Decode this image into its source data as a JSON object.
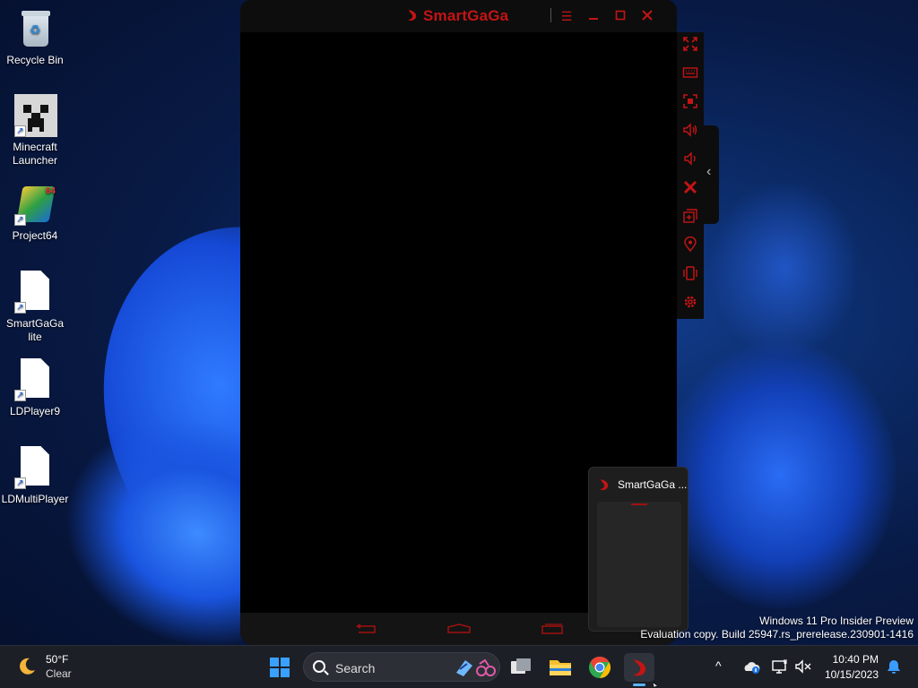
{
  "desktop": {
    "icons": [
      {
        "label": "Recycle Bin",
        "icon": "recycle-bin-icon"
      },
      {
        "label": "Minecraft Launcher",
        "icon": "minecraft-icon"
      },
      {
        "label": "Project64",
        "icon": "project64-icon"
      },
      {
        "label": "SmartGaGa lite",
        "icon": "file-icon"
      },
      {
        "label": "LDPlayer9",
        "icon": "file-icon"
      },
      {
        "label": "LDMultiPlayer",
        "icon": "file-icon"
      }
    ]
  },
  "smartgaga": {
    "title": "SmartGaGa",
    "accent": "#c41414",
    "toolbar": [
      "fullscreen-icon",
      "keyboard-icon",
      "screenshot-icon",
      "volume-up-icon",
      "volume-down-icon",
      "close-app-icon",
      "multi-instance-icon",
      "location-icon",
      "shake-icon",
      "settings-icon"
    ]
  },
  "thumbnail": {
    "title": "SmartGaGa ..."
  },
  "watermark": {
    "line1": "Windows 11 Pro Insider Preview",
    "line2": "Evaluation copy. Build 25947.rs_prerelease.230901-1416"
  },
  "taskbar": {
    "weather": {
      "temp": "50°F",
      "condition": "Clear"
    },
    "search": {
      "placeholder": "Search"
    },
    "clock": {
      "time": "10:40 PM",
      "date": "10/15/2023"
    }
  }
}
